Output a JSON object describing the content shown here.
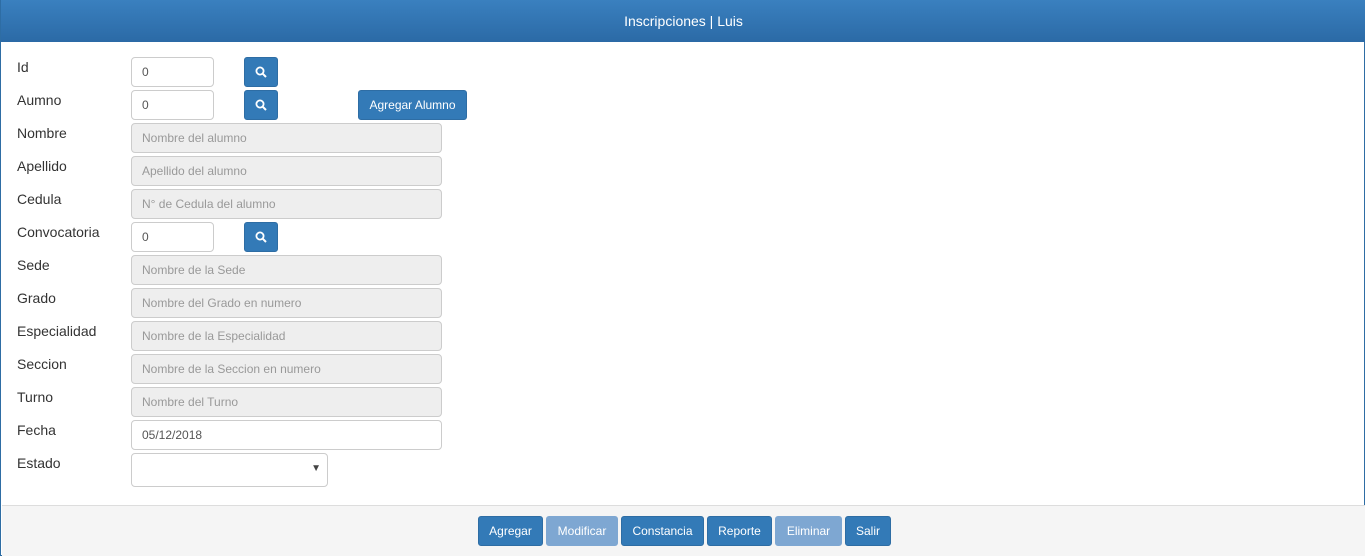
{
  "window": {
    "title": "Inscripciones | Luis"
  },
  "form": {
    "id": {
      "label": "Id",
      "value": "0"
    },
    "alumno": {
      "label": "Aumno",
      "value": "0",
      "add_button": "Agregar Alumno"
    },
    "nombre": {
      "label": "Nombre",
      "placeholder": "Nombre del alumno"
    },
    "apellido": {
      "label": "Apellido",
      "placeholder": "Apellido del alumno"
    },
    "cedula": {
      "label": "Cedula",
      "placeholder": "N° de Cedula del alumno"
    },
    "convocatoria": {
      "label": "Convocatoria",
      "value": "0"
    },
    "sede": {
      "label": "Sede",
      "placeholder": "Nombre de la Sede"
    },
    "grado": {
      "label": "Grado",
      "placeholder": "Nombre del Grado en numero"
    },
    "especialidad": {
      "label": "Especialidad",
      "placeholder": "Nombre de la Especialidad"
    },
    "seccion": {
      "label": "Seccion",
      "placeholder": "Nombre de la Seccion en numero"
    },
    "turno": {
      "label": "Turno",
      "placeholder": "Nombre del Turno"
    },
    "fecha": {
      "label": "Fecha",
      "value": "05/12/2018"
    },
    "estado": {
      "label": "Estado",
      "value": ""
    }
  },
  "footer": {
    "agregar": "Agregar",
    "modificar": "Modificar",
    "constancia": "Constancia",
    "reporte": "Reporte",
    "eliminar": "Eliminar",
    "salir": "Salir"
  },
  "icons": {
    "search": "search-icon",
    "caret": "caret-down-icon"
  },
  "colors": {
    "primary": "#337ab7",
    "disabled": "#7ea7d2",
    "titlebar": "#2b6aa6"
  }
}
